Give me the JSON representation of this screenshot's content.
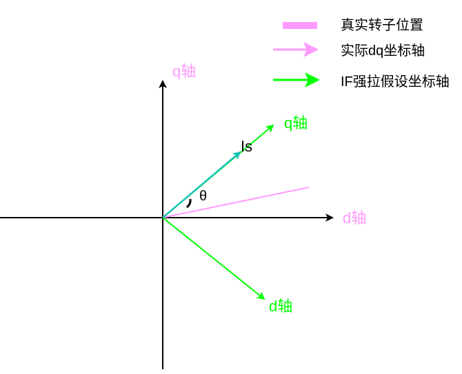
{
  "legend": {
    "items": [
      {
        "label": "真实转子位置",
        "color": "#ff99ff"
      },
      {
        "label": "实际dq坐标轴",
        "color": "#ff99ff"
      },
      {
        "label": "IF强拉假设坐标轴",
        "color": "#00ff00"
      }
    ]
  },
  "labels": {
    "actual_q": "q轴",
    "actual_d": "d轴",
    "assumed_q": "q轴",
    "assumed_d": "d轴",
    "current_vector": "Is",
    "angle": "θ"
  },
  "colors": {
    "axis": "#000000",
    "actual_axis_text": "#ff99ff",
    "assumed_axis": "#00ff00",
    "rotor_position": "#ff99ff",
    "current_vector": "#19c3b6"
  }
}
